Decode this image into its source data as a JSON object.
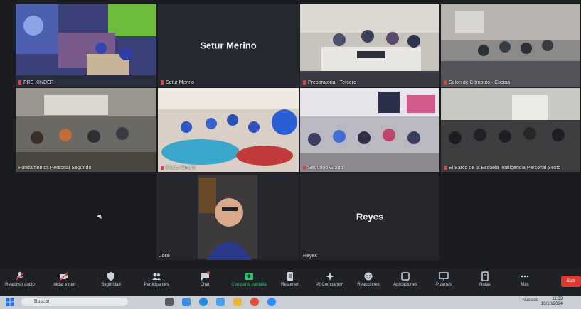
{
  "tiles": [
    {
      "id": "t1",
      "name": "PRE KINDER",
      "kind": "video"
    },
    {
      "id": "t2",
      "name": "Setur Merino",
      "kind": "avatar",
      "center": "Setur Merino"
    },
    {
      "id": "t3",
      "name": "Preparatoria - Tercero",
      "kind": "video"
    },
    {
      "id": "t4",
      "name": "Salon de Cómputo - Cocina",
      "kind": "video"
    },
    {
      "id": "t5",
      "name": "Fundamentos Personal Segundo",
      "kind": "video"
    },
    {
      "id": "t6",
      "name": "Kinder Grado",
      "kind": "video"
    },
    {
      "id": "t7",
      "name": "Segundo Grado",
      "kind": "video"
    },
    {
      "id": "t8",
      "name": "El Barco de la Escuela Inteligencia Personal Sexto",
      "kind": "video"
    },
    {
      "id": "t9",
      "name": "José",
      "kind": "video",
      "active": true
    },
    {
      "id": "t10",
      "name": "Reyes",
      "kind": "avatar",
      "center": "Reyes"
    }
  ],
  "toolbar": {
    "items": [
      {
        "label": "Reactivar audio",
        "icon": "mic-muted-icon"
      },
      {
        "label": "Iniciar vídeo",
        "icon": "video-off-icon"
      },
      {
        "label": "Seguridad",
        "icon": "shield-icon"
      },
      {
        "label": "Participantes",
        "icon": "participants-icon",
        "badge": "10"
      },
      {
        "label": "Chat",
        "icon": "chat-icon"
      },
      {
        "label": "Compartir pantalla",
        "icon": "share-screen-icon"
      },
      {
        "label": "Resumen",
        "icon": "summary-icon"
      },
      {
        "label": "AI Companion",
        "icon": "ai-companion-icon"
      },
      {
        "label": "Reacciones",
        "icon": "reactions-icon"
      },
      {
        "label": "Aplicaciones",
        "icon": "apps-icon"
      },
      {
        "label": "Pizarras",
        "icon": "whiteboard-icon"
      },
      {
        "label": "Notas",
        "icon": "notes-icon"
      },
      {
        "label": "Más",
        "icon": "more-icon"
      }
    ],
    "leave_label": "Salir"
  },
  "taskbar": {
    "search_placeholder": "Buscar",
    "tray_text": "Nublado",
    "time": "11:33",
    "date": "10/10/2024"
  },
  "colors": {
    "active_border": "#b9d77d",
    "share_green": "#29c46d",
    "leave_red": "#d93a32"
  }
}
